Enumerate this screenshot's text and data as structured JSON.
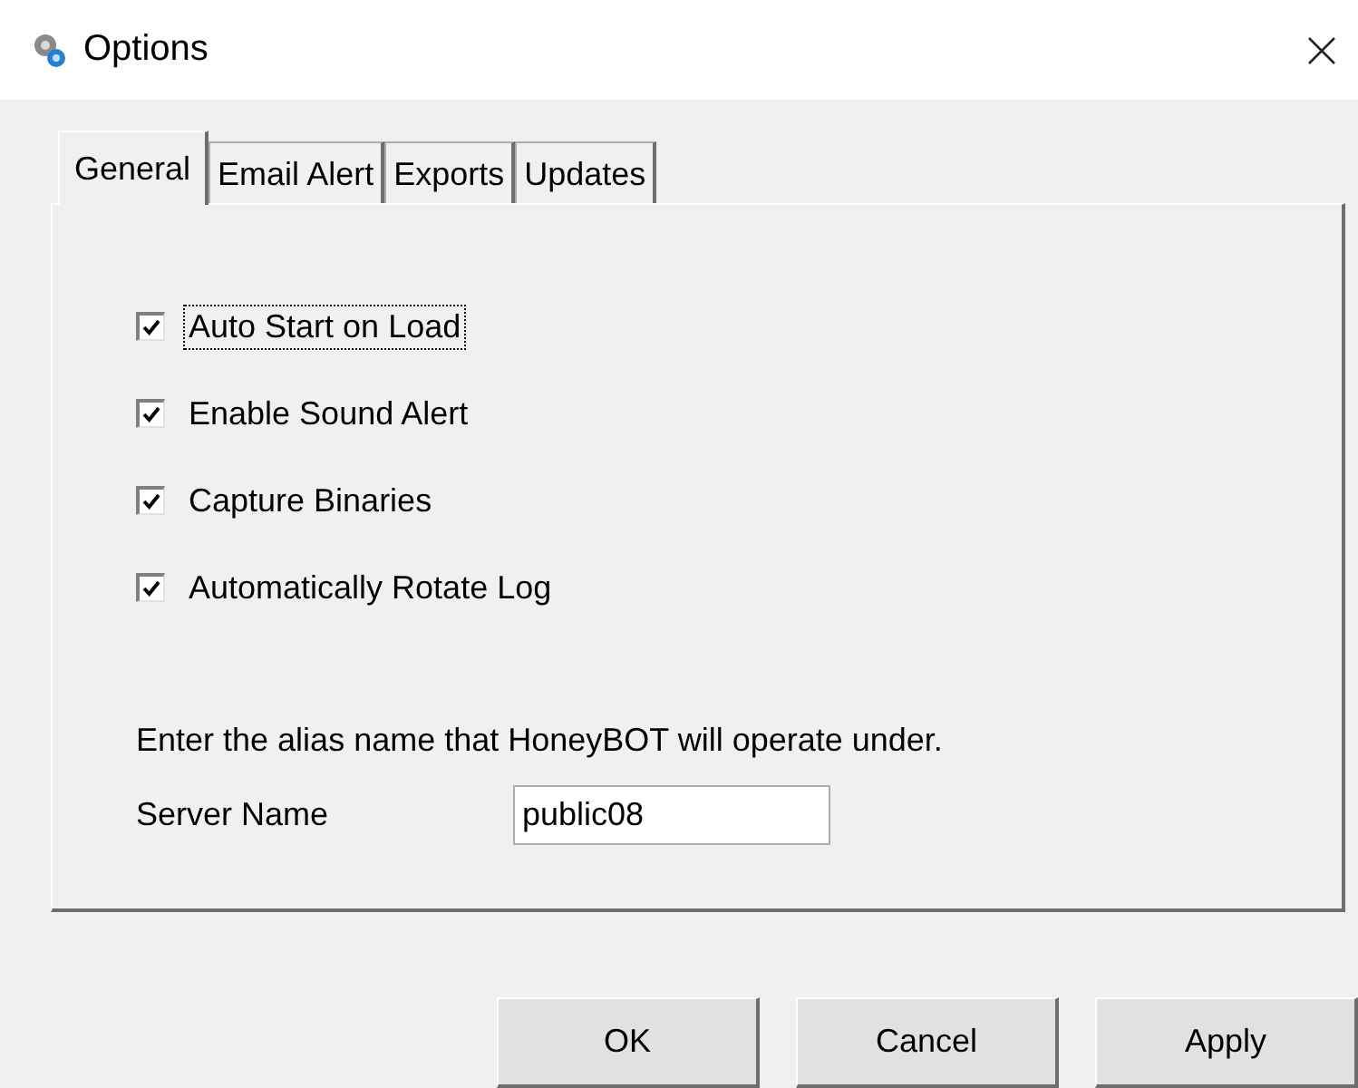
{
  "window": {
    "title": "Options"
  },
  "tabs": [
    {
      "label": "General",
      "selected": true
    },
    {
      "label": "Email Alert",
      "selected": false
    },
    {
      "label": "Exports",
      "selected": false
    },
    {
      "label": "Updates",
      "selected": false
    }
  ],
  "options": [
    {
      "label": "Auto Start on Load",
      "checked": true,
      "focused": true
    },
    {
      "label": "Enable Sound Alert",
      "checked": true,
      "focused": false
    },
    {
      "label": "Capture Binaries",
      "checked": true,
      "focused": false
    },
    {
      "label": "Automatically Rotate Log",
      "checked": true,
      "focused": false
    }
  ],
  "alias_hint": "Enter the alias name that HoneyBOT will operate under.",
  "server_name": {
    "label": "Server Name",
    "value": "public08"
  },
  "buttons": [
    "OK",
    "Cancel",
    "Apply"
  ]
}
